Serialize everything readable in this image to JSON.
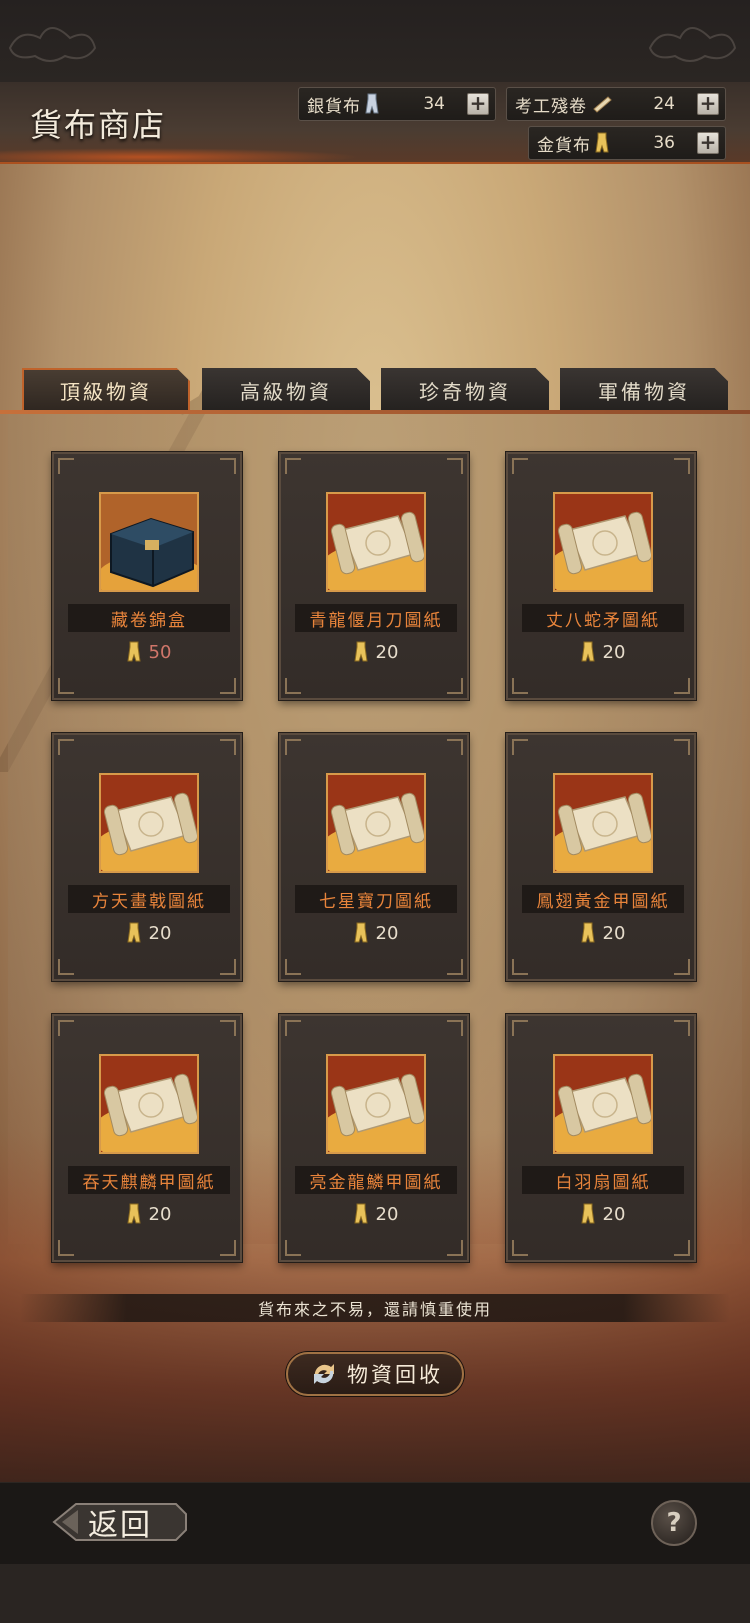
{
  "header": {
    "title": "貨布商店"
  },
  "currencies": [
    {
      "label": "銀貨布",
      "icon": "silver-coin-icon",
      "value": "34"
    },
    {
      "label": "考工殘卷",
      "icon": "scroll-fragment-icon",
      "value": "24"
    },
    {
      "label": "金貨布",
      "icon": "gold-coin-icon",
      "value": "36"
    }
  ],
  "tabs": [
    {
      "label": "頂級物資",
      "active": true
    },
    {
      "label": "高級物資",
      "active": false
    },
    {
      "label": "珍奇物資",
      "active": false
    },
    {
      "label": "軍備物資",
      "active": false
    }
  ],
  "items": [
    {
      "name": "藏卷錦盒",
      "price": "50",
      "thumb": "treasure-chest-icon",
      "unaffordable": true
    },
    {
      "name": "青龍偃月刀圖紙",
      "price": "20",
      "thumb": "scroll-blueprint-icon"
    },
    {
      "name": "丈八蛇矛圖紙",
      "price": "20",
      "thumb": "scroll-blueprint-icon"
    },
    {
      "name": "方天畫戟圖紙",
      "price": "20",
      "thumb": "scroll-blueprint-icon"
    },
    {
      "name": "七星寶刀圖紙",
      "price": "20",
      "thumb": "scroll-blueprint-icon"
    },
    {
      "name": "鳳翅黃金甲圖紙",
      "price": "20",
      "thumb": "scroll-blueprint-icon"
    },
    {
      "name": "吞天麒麟甲圖紙",
      "price": "20",
      "thumb": "scroll-blueprint-icon"
    },
    {
      "name": "亮金龍鱗甲圖紙",
      "price": "20",
      "thumb": "scroll-blueprint-icon"
    },
    {
      "name": "白羽扇圖紙",
      "price": "20",
      "thumb": "scroll-blueprint-icon"
    }
  ],
  "notice": "貨布來之不易，還請慎重使用",
  "recycle_button": "物資回收",
  "back_button": "返回",
  "help_button": "?",
  "colors": {
    "accent": "#c0632b",
    "item_name": "#e8843b",
    "unaffordable_price": "#d0766a"
  }
}
